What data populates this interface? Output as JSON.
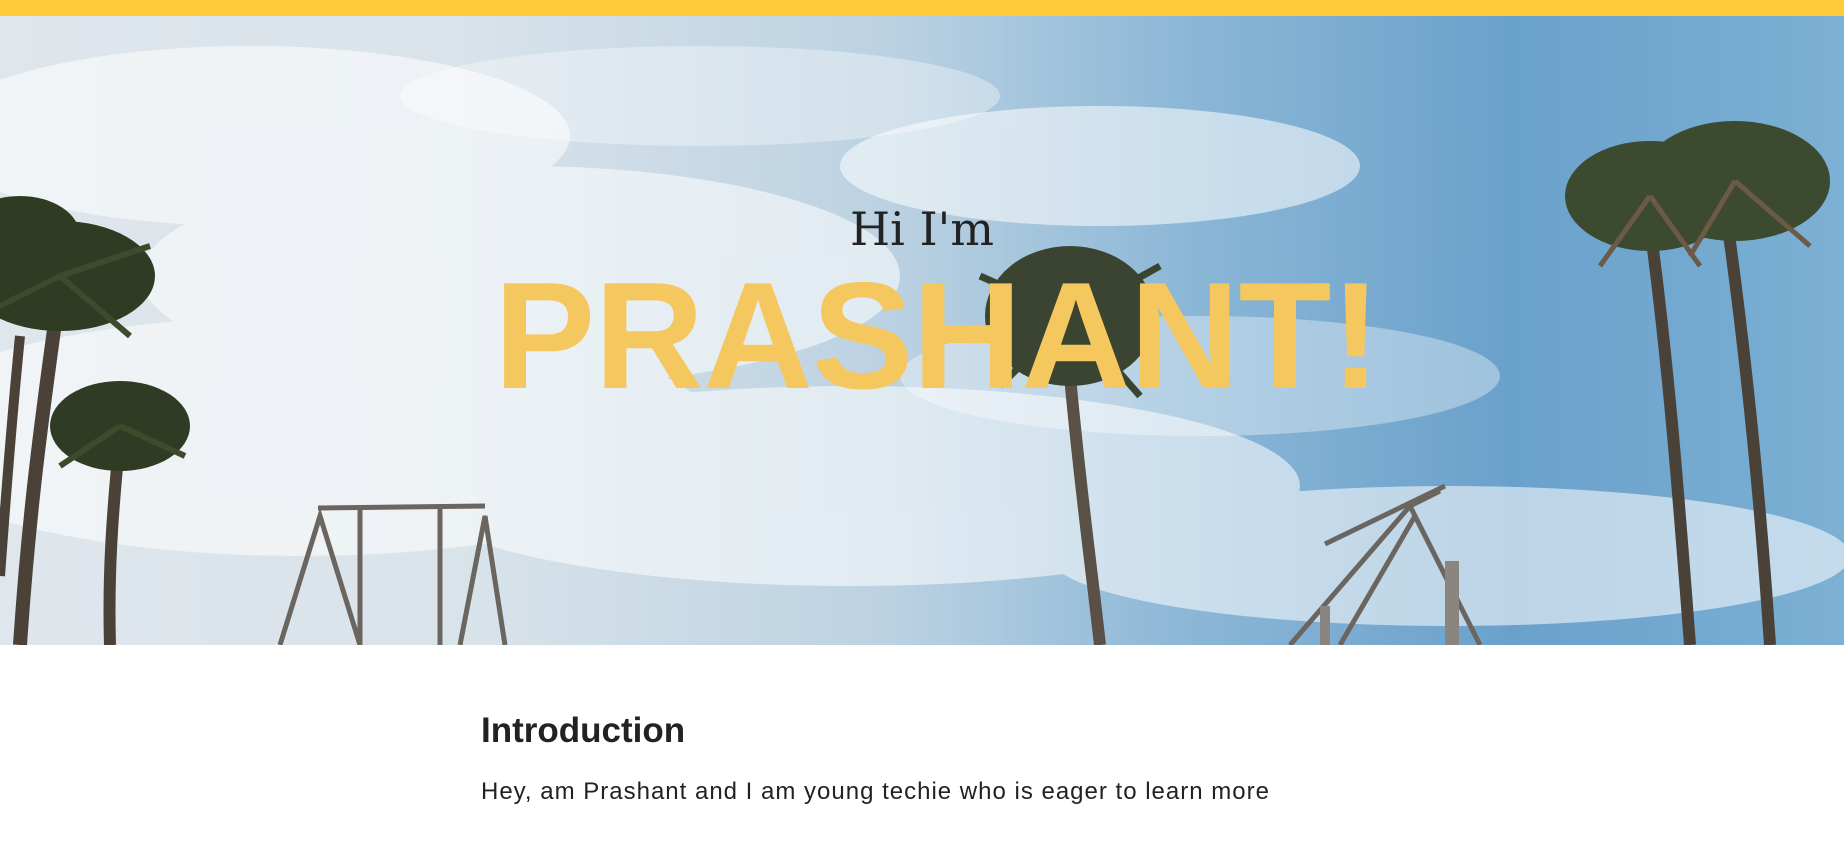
{
  "hero": {
    "greeting": "Hi I'm",
    "name": "PRASHANT!"
  },
  "intro": {
    "title": "Introduction",
    "text": "Hey, am Prashant and I am young techie who is eager to learn more"
  },
  "colors": {
    "top_bar": "#FFCB3D",
    "name_accent": "#F4C85E",
    "text_dark": "#222222",
    "sky": "#6AA1CB"
  }
}
